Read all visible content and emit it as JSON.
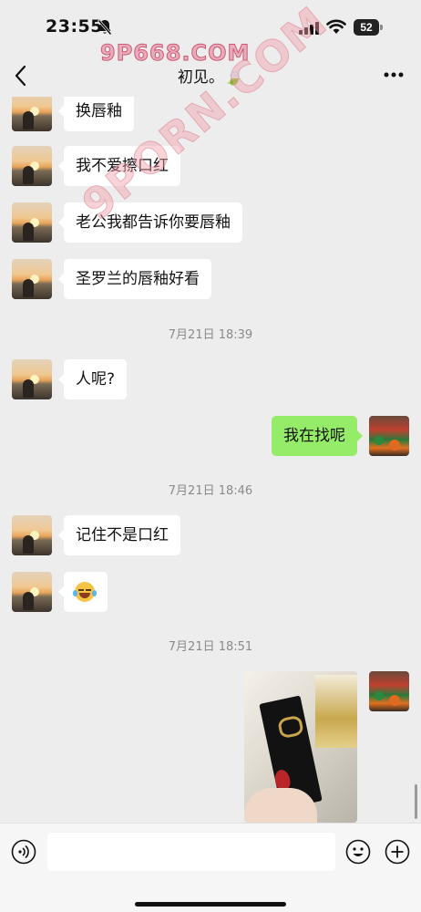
{
  "status_bar": {
    "time": "23:55",
    "battery": "52",
    "icons": [
      "bell-slash-icon",
      "signal-icon",
      "wifi-icon",
      "battery-icon"
    ]
  },
  "watermark": {
    "top": "9P668.COM",
    "diagonal": "9PORN.COM"
  },
  "nav": {
    "title": "初见。🍃",
    "back_icon": "chevron-left-icon",
    "more_icon": "ellipsis-icon"
  },
  "messages": [
    {
      "side": "left",
      "text": "换唇釉"
    },
    {
      "side": "left",
      "text": "我不爱擦口红"
    },
    {
      "side": "left",
      "text": "老公我都告诉你要唇釉"
    },
    {
      "side": "left",
      "text": "圣罗兰的唇釉好看"
    },
    {
      "type": "time",
      "text": "7月21日 18:39"
    },
    {
      "side": "left",
      "text": "人呢?"
    },
    {
      "side": "right",
      "text": "我在找呢"
    },
    {
      "type": "time",
      "text": "7月21日 18:46"
    },
    {
      "side": "left",
      "text": "记住不是口红"
    },
    {
      "side": "left",
      "type": "emoji",
      "emoji": "rolling-laughing-emoji"
    },
    {
      "type": "time",
      "text": "7月21日 18:51"
    },
    {
      "side": "right",
      "type": "image",
      "image": "lipstick-photo"
    }
  ],
  "input_bar": {
    "placeholder": "",
    "voice_icon": "voice-icon",
    "emoji_icon": "emoji-icon",
    "plus_icon": "plus-icon"
  },
  "colors": {
    "background": "#ededed",
    "bubble_left": "#ffffff",
    "bubble_right": "#95ec69",
    "timestamp": "#8a8a8a"
  }
}
